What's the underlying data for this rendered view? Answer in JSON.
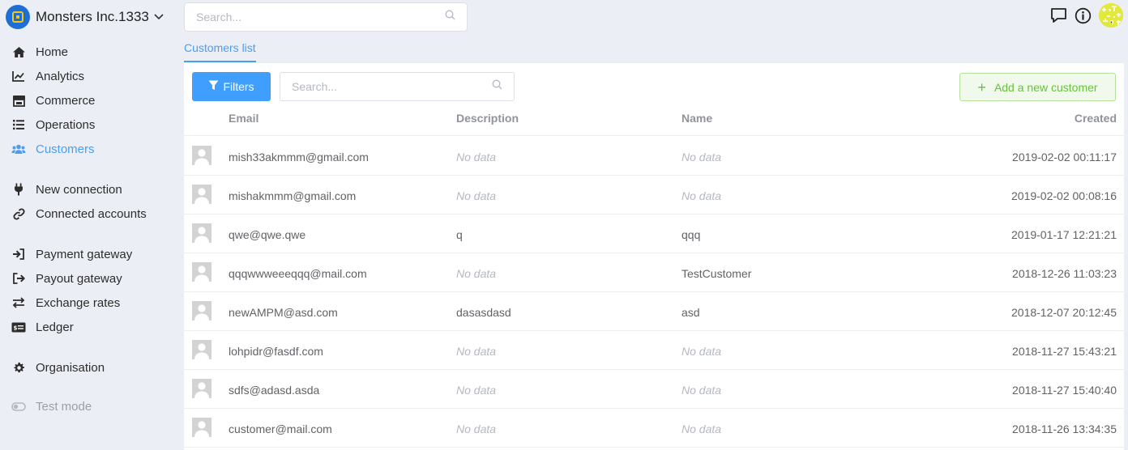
{
  "org": {
    "name": "Monsters Inc.1333"
  },
  "search": {
    "placeholder": "Search..."
  },
  "nav": {
    "home": "Home",
    "analytics": "Analytics",
    "commerce": "Commerce",
    "operations": "Operations",
    "customers": "Customers",
    "new_connection": "New connection",
    "connected_accounts": "Connected accounts",
    "payment_gateway": "Payment gateway",
    "payout_gateway": "Payout gateway",
    "exchange_rates": "Exchange rates",
    "ledger": "Ledger",
    "organisation": "Organisation",
    "test_mode": "Test mode"
  },
  "tab": {
    "label": "Customers list"
  },
  "toolbar": {
    "filters_label": "Filters",
    "search_placeholder": "Search...",
    "add_label": "Add a new customer"
  },
  "table": {
    "headers": {
      "email": "Email",
      "description": "Description",
      "name": "Name",
      "created": "Created"
    },
    "rows": [
      {
        "email": "mish33akmmm@gmail.com",
        "description": "No data",
        "name": "No data",
        "created": "2019-02-02 00:11:17"
      },
      {
        "email": "mishakmmm@gmail.com",
        "description": "No data",
        "name": "No data",
        "created": "2019-02-02 00:08:16"
      },
      {
        "email": "qwe@qwe.qwe",
        "description": "q",
        "name": "qqq",
        "created": "2019-01-17 12:21:21"
      },
      {
        "email": "qqqwwweeeqqq@mail.com",
        "description": "No data",
        "name": "TestCustomer",
        "created": "2018-12-26 11:03:23"
      },
      {
        "email": "newAMPM@asd.com",
        "description": "dasasdasd",
        "name": "asd",
        "created": "2018-12-07 20:12:45"
      },
      {
        "email": "lohpidr@fasdf.com",
        "description": "No data",
        "name": "No data",
        "created": "2018-11-27 15:43:21"
      },
      {
        "email": "sdfs@adasd.asda",
        "description": "No data",
        "name": "No data",
        "created": "2018-11-27 15:40:40"
      },
      {
        "email": "customer@mail.com",
        "description": "No data",
        "name": "No data",
        "created": "2018-11-26 13:34:35"
      }
    ]
  },
  "colors": {
    "accent": "#409eff",
    "active_nav": "#4a9ef0",
    "success": "#67c23a",
    "background": "#eceef6"
  }
}
